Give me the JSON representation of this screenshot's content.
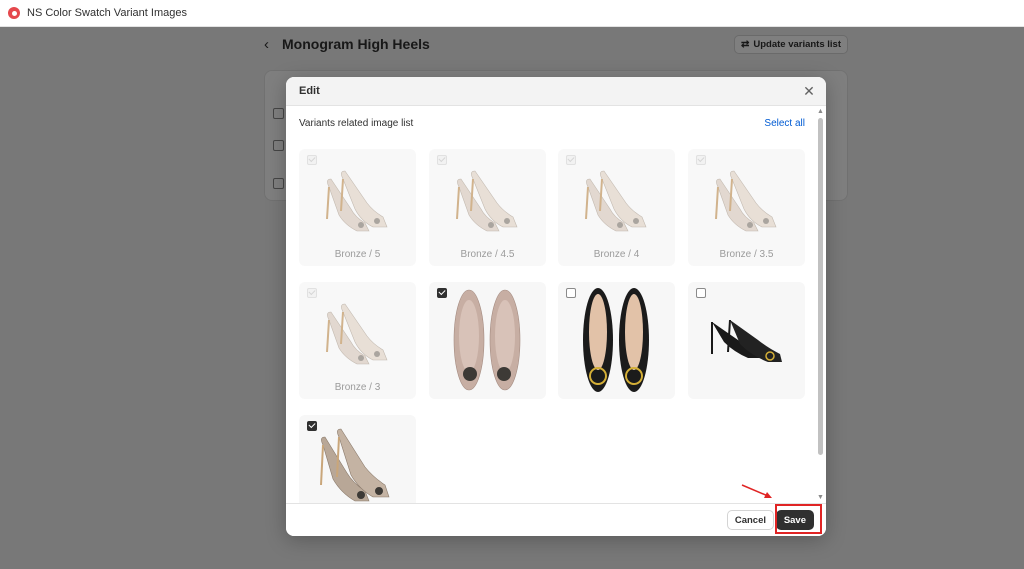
{
  "app": {
    "title": "NS Color Swatch Variant Images",
    "logo_icon": "app-logo-icon"
  },
  "page": {
    "title": "Monogram High Heels",
    "back_icon": "‹",
    "update_button": "Update variants list",
    "update_icon": "⇄"
  },
  "modal": {
    "title": "Edit",
    "close_icon": "✕",
    "section_label": "Variants related image list",
    "select_all": "Select all",
    "tiles": [
      {
        "label": "Bronze / 5",
        "state": "disabled",
        "image": "bronze-pumps"
      },
      {
        "label": "Bronze / 4.5",
        "state": "disabled",
        "image": "bronze-pumps"
      },
      {
        "label": "Bronze / 4",
        "state": "disabled",
        "image": "bronze-pumps"
      },
      {
        "label": "Bronze / 3.5",
        "state": "disabled",
        "image": "bronze-pumps"
      },
      {
        "label": "Bronze / 3",
        "state": "disabled",
        "image": "bronze-pumps"
      },
      {
        "label": "",
        "state": "checked",
        "image": "taupe-pumps-top"
      },
      {
        "label": "",
        "state": "unchecked",
        "image": "black-pumps-top"
      },
      {
        "label": "",
        "state": "unchecked",
        "image": "black-pumps-side"
      },
      {
        "label": "",
        "state": "checked",
        "image": "python-pumps"
      }
    ],
    "footer": {
      "cancel": "Cancel",
      "save": "Save"
    }
  },
  "colors": {
    "accent_link": "#005bd3",
    "primary_button": "#303030",
    "annotation_red": "#e02424"
  }
}
